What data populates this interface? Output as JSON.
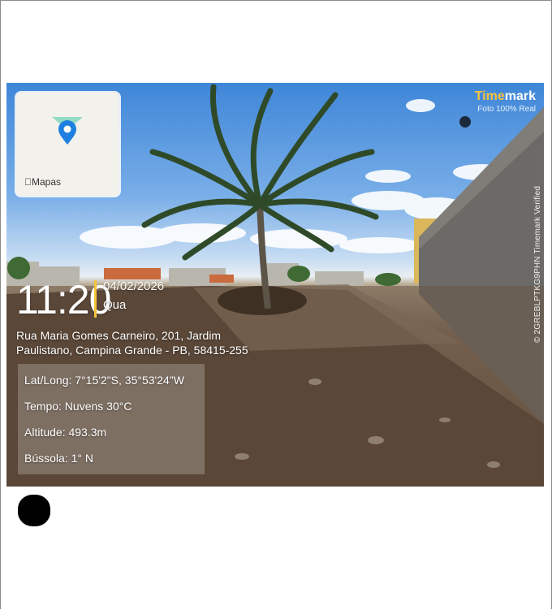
{
  "map_card": {
    "label": "Mapas",
    "icon": "map-pin-icon"
  },
  "brand": {
    "name_highlight": "Time",
    "name_rest": "mark",
    "subtitle": "Foto 100% Real",
    "accent": "#f6c33d"
  },
  "verification": {
    "text": "© 2GREBLPTKG9PHN  Timemark Verified"
  },
  "datetime": {
    "time": "11:20",
    "date": "04/02/2026",
    "weekday": "Qua"
  },
  "address": {
    "line1": "Rua Maria Gomes Carneiro, 201, Jardim",
    "line2": "Paulistano, Campina Grande - PB, 58415-255"
  },
  "info": {
    "latlong": "Lat/Long: 7°15'2\"S, 35°53'24\"W",
    "weather": "Tempo: Nuvens 30°C",
    "altitude": "Altitude: 493.3m",
    "compass": "Bússola: 1° N"
  }
}
